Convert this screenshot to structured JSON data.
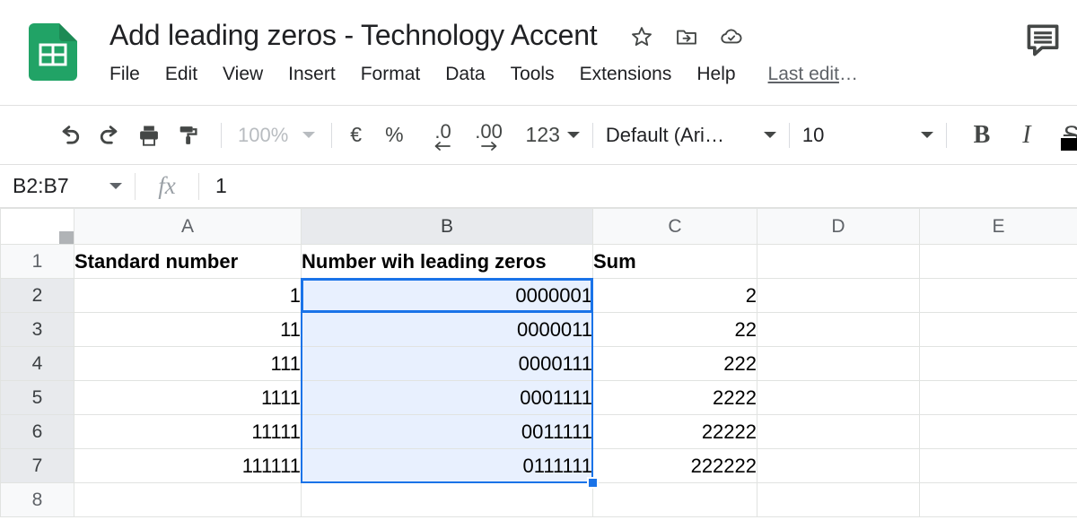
{
  "header": {
    "logo_icon": "sheets-logo-icon",
    "doc_title": "Add leading zeros - Technology Accent",
    "title_icons": [
      {
        "name": "star-icon",
        "label": "Star"
      },
      {
        "name": "move-to-folder-icon",
        "label": "Move"
      },
      {
        "name": "cloud-saved-icon",
        "label": "Saved to Drive"
      }
    ],
    "menu_items": [
      "File",
      "Edit",
      "View",
      "Insert",
      "Format",
      "Data",
      "Tools",
      "Extensions",
      "Help"
    ],
    "last_edit": "Last edit",
    "last_edit_ellipsis": "…",
    "comment_icon": "comment-icon"
  },
  "toolbar": {
    "undo_icon": "undo-icon",
    "redo_icon": "redo-icon",
    "print_icon": "print-icon",
    "paint_format_icon": "paint-format-icon",
    "zoom_value": "100%",
    "currency_label": "€",
    "percent_label": "%",
    "decrease_decimal_label": ".0",
    "increase_decimal_label": ".00",
    "number_format_label": "123",
    "font_value": "Default (Ari…",
    "font_size_value": "10",
    "bold_label": "B",
    "italic_label": "I",
    "strikethrough_label": "S",
    "text_color_icon": "text-color-icon"
  },
  "formula_bar": {
    "name_box_value": "B2:B7",
    "fx_label": "fx",
    "formula_value": "1"
  },
  "grid": {
    "columns": [
      "A",
      "B",
      "C",
      "D",
      "E"
    ],
    "selected_column": "B",
    "rows": [
      "1",
      "2",
      "3",
      "4",
      "5",
      "6",
      "7",
      "8"
    ],
    "selected_rows": [
      "2",
      "3",
      "4",
      "5",
      "6",
      "7"
    ],
    "cells": [
      {
        "row": "1",
        "A": "Standard number",
        "B": "Number wih leading zeros",
        "C": "Sum",
        "D": "",
        "E": "",
        "type": "header"
      },
      {
        "row": "2",
        "A": "1",
        "B": "0000001",
        "C": "2",
        "D": "",
        "E": "",
        "type": "data"
      },
      {
        "row": "3",
        "A": "11",
        "B": "0000011",
        "C": "22",
        "D": "",
        "E": "",
        "type": "data"
      },
      {
        "row": "4",
        "A": "111",
        "B": "0000111",
        "C": "222",
        "D": "",
        "E": "",
        "type": "data"
      },
      {
        "row": "5",
        "A": "1111",
        "B": "0001111",
        "C": "2222",
        "D": "",
        "E": "",
        "type": "data"
      },
      {
        "row": "6",
        "A": "11111",
        "B": "0011111",
        "C": "22222",
        "D": "",
        "E": "",
        "type": "data"
      },
      {
        "row": "7",
        "A": "111111",
        "B": "0111111",
        "C": "222222",
        "D": "",
        "E": "",
        "type": "data"
      },
      {
        "row": "8",
        "A": "",
        "B": "",
        "C": "",
        "D": "",
        "E": "",
        "type": "data"
      }
    ],
    "selection_range": "B2:B7",
    "active_cell": "B2"
  },
  "colors": {
    "brand_green": "#21a366",
    "selection_blue": "#1a73e8",
    "selection_fill": "#e8f0fe",
    "header_gray": "#f8f9fa",
    "header_selected_gray": "#e8eaed",
    "grid_line": "#e1e3e1",
    "text_primary": "#202124",
    "text_secondary": "#5f6368"
  }
}
